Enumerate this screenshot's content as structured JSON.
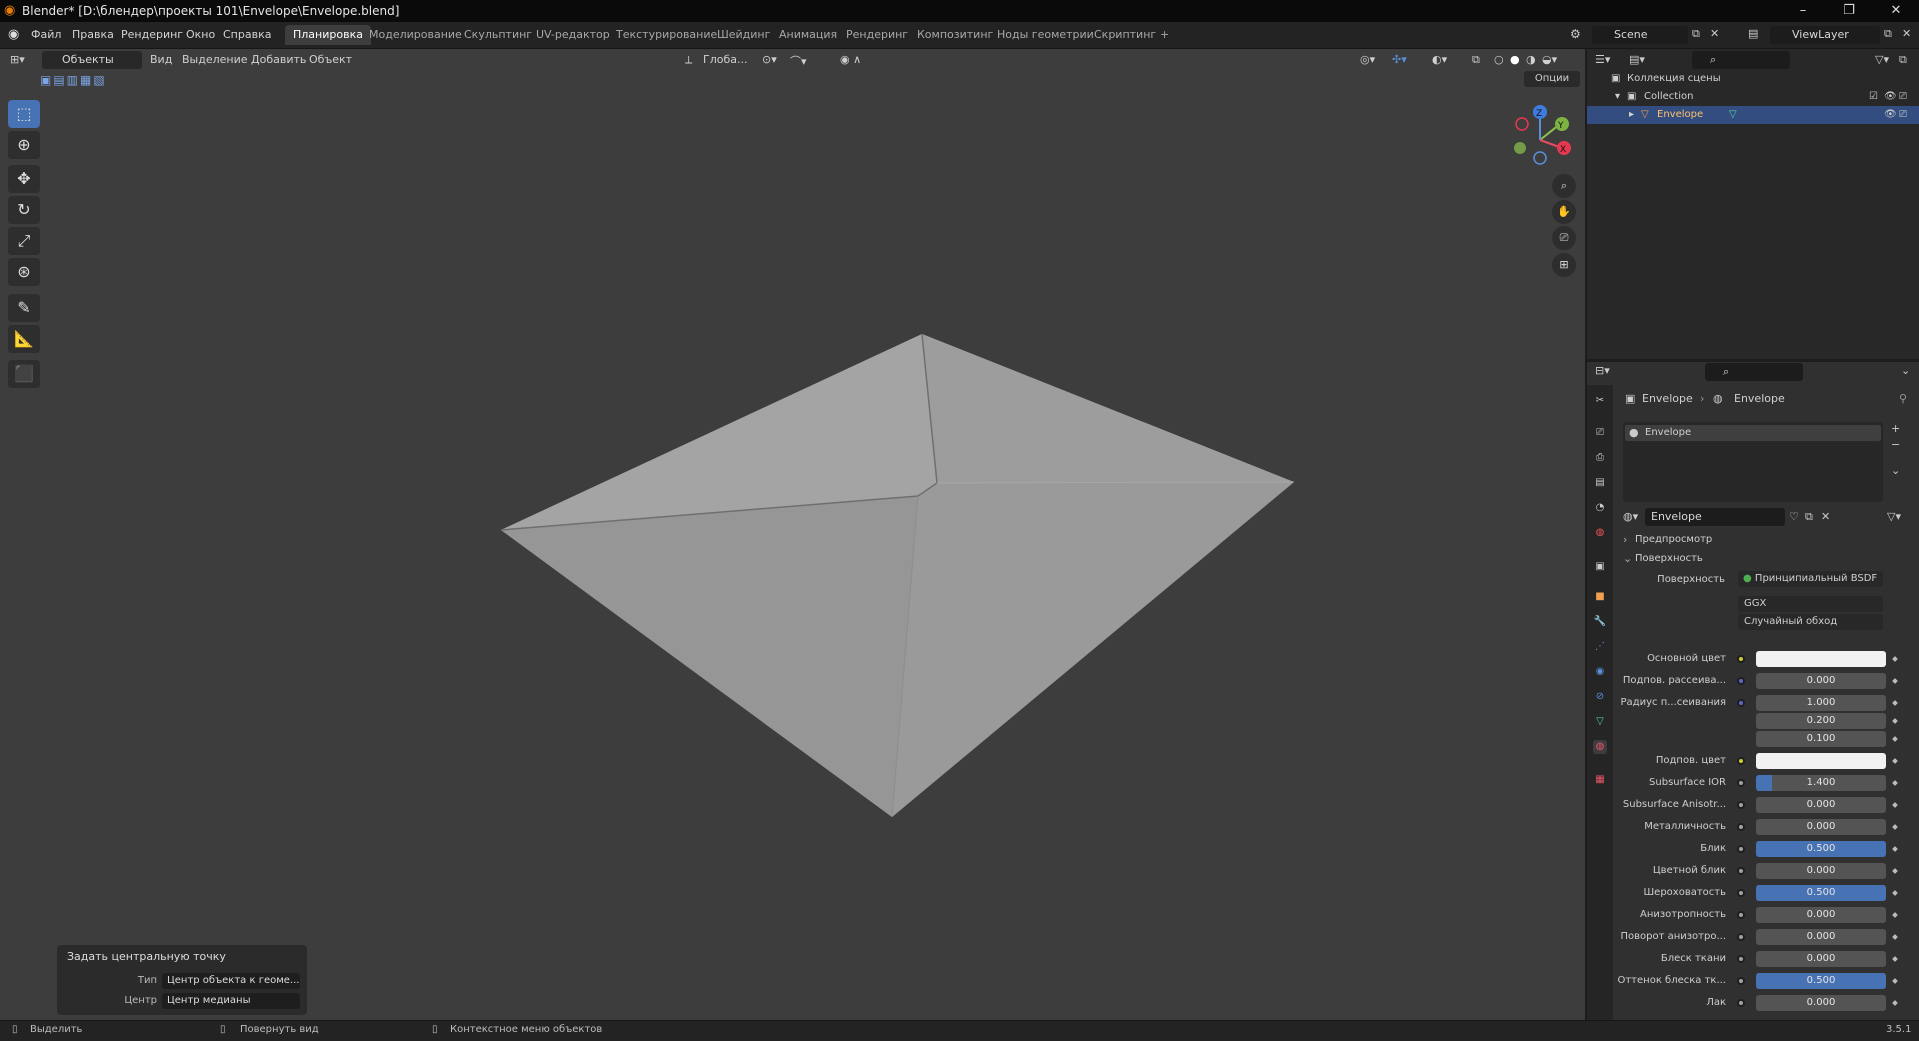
{
  "window": {
    "title": "Blender* [D:\\блендер\\проекты 101\\Envelope\\Envelope.blend]",
    "min": "–",
    "max": "❐",
    "close": "✕"
  },
  "menu": [
    "Файл",
    "Правка",
    "Рендеринг",
    "Окно",
    "Справка"
  ],
  "workspaces": [
    "Планировка",
    "Моделирование",
    "Скульптинг",
    "UV-редактор",
    "Текстурирование",
    "Шейдинг",
    "Анимация",
    "Рендеринг",
    "Композитинг",
    "Ноды геометрии",
    "Скриптинг",
    "+"
  ],
  "active_workspace": "Планировка",
  "scene": {
    "name": "Scene",
    "view_layer": "ViewLayer"
  },
  "viewport_header": {
    "mode": "Объекты",
    "menus": [
      "Вид",
      "Выделение",
      "Добавить",
      "Объект"
    ],
    "orientation": "Глоба...",
    "options": "Опции"
  },
  "gizmo": {
    "z": "Z",
    "y": "Y",
    "x": "X"
  },
  "redo_panel": {
    "title": "Задать центральную точку",
    "type_label": "Тип",
    "type_value": "Центр объекта к геоме...",
    "center_label": "Центр",
    "center_value": "Центр медианы"
  },
  "outliner": {
    "scene_collection": "Коллекция сцены",
    "collection": "Collection",
    "object": "Envelope"
  },
  "properties": {
    "breadcrumb_object": "Envelope",
    "breadcrumb_material": "Envelope",
    "material_slot": "Envelope",
    "material_name": "Envelope",
    "panels": {
      "preview": "Предпросмотр",
      "surface": "Поверхность"
    },
    "surface_label": "Поверхность",
    "surface_shader": "Принципиальный BSDF",
    "distribution": "GGX",
    "subsurface_method": "Случайный обход",
    "rows": [
      {
        "label": "Основной цвет",
        "value": "",
        "fill": 0,
        "color": "#f2f2f2",
        "dot": "yellow"
      },
      {
        "label": "Подпов. рассеива...",
        "value": "0.000",
        "fill": 0,
        "dot": "blue"
      },
      {
        "label": "Радиус п...сеивания",
        "value": "1.000",
        "fill": 0,
        "dot": "blue"
      },
      {
        "label": "",
        "value": "0.200",
        "fill": 0,
        "dot": "none"
      },
      {
        "label": "",
        "value": "0.100",
        "fill": 0,
        "dot": "none"
      },
      {
        "label": "Подпов. цвет",
        "value": "",
        "fill": 0,
        "color": "#f2f2f2",
        "dot": "yellow"
      },
      {
        "label": "Subsurface IOR",
        "value": "1.400",
        "fill": 0.12,
        "dot": "grey"
      },
      {
        "label": "Subsurface Anisotr...",
        "value": "0.000",
        "fill": 0,
        "dot": "grey"
      },
      {
        "label": "Металличность",
        "value": "0.000",
        "fill": 0,
        "dot": "grey"
      },
      {
        "label": "Блик",
        "value": "0.500",
        "fill": 1,
        "dot": "grey"
      },
      {
        "label": "Цветной блик",
        "value": "0.000",
        "fill": 0,
        "dot": "grey"
      },
      {
        "label": "Шероховатость",
        "value": "0.500",
        "fill": 1,
        "dot": "grey"
      },
      {
        "label": "Анизотропность",
        "value": "0.000",
        "fill": 0,
        "dot": "grey"
      },
      {
        "label": "Поворот анизотро...",
        "value": "0.000",
        "fill": 0,
        "dot": "grey"
      },
      {
        "label": "Блеск ткани",
        "value": "0.000",
        "fill": 0,
        "dot": "grey"
      },
      {
        "label": "Оттенок блеска тк...",
        "value": "0.500",
        "fill": 1,
        "dot": "grey"
      },
      {
        "label": "Лак",
        "value": "0.000",
        "fill": 0,
        "dot": "grey"
      }
    ]
  },
  "statusbar": {
    "select": "Выделить",
    "rotate": "Повернуть вид",
    "context": "Контекстное меню объектов",
    "version": "3.5.1"
  },
  "colors": {
    "accent": "#4772b3",
    "viewport_bg": "#3d3d3d",
    "envelope": "#9c9c9c"
  }
}
